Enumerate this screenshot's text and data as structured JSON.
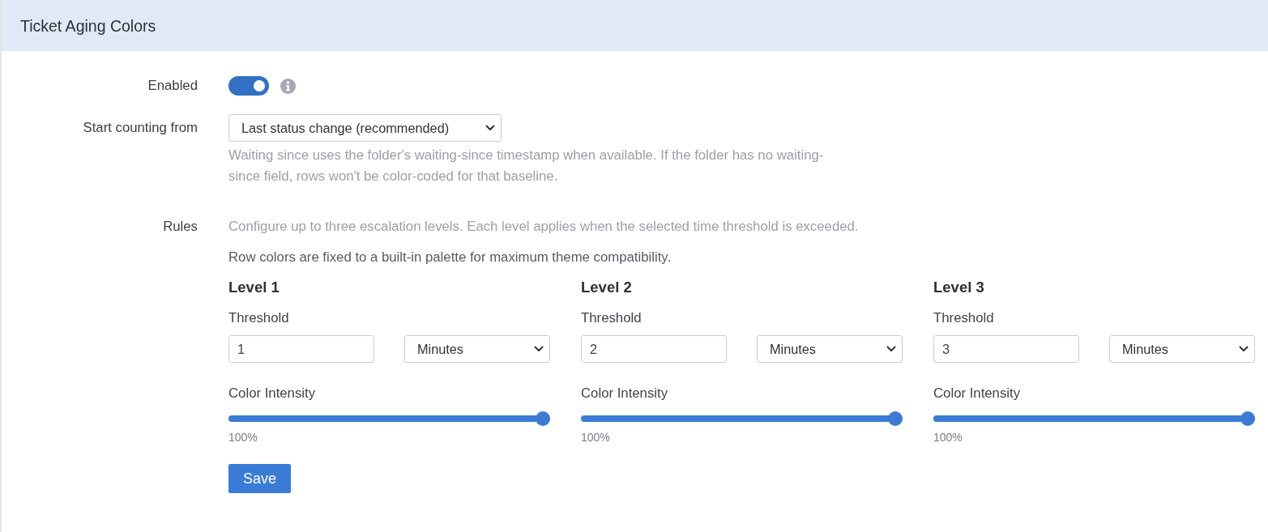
{
  "panel": {
    "title": "Ticket Aging Colors"
  },
  "enabled": {
    "label": "Enabled",
    "on": true
  },
  "start_counting": {
    "label": "Start counting from",
    "value": "Last status change (recommended)",
    "help": "Waiting since uses the folder's waiting-since timestamp when available. If the folder has no waiting-since field, rows won't be color-coded for that baseline."
  },
  "rules": {
    "label": "Rules",
    "description": "Configure up to three escalation levels. Each level applies when the selected time threshold is exceeded.",
    "note": "Row colors are fixed to a built-in palette for maximum theme compatibility.",
    "levels": [
      {
        "title": "Level 1",
        "threshold_label": "Threshold",
        "threshold": "1",
        "unit": "Minutes",
        "intensity_label": "Color Intensity",
        "level": 1,
        "reading": "100%"
      },
      {
        "title": "Level 2",
        "threshold_label": "Threshold",
        "threshold": "2",
        "unit": "Minutes",
        "intensity_label": "Color Intensity",
        "level": 1,
        "reading": "100%"
      },
      {
        "title": "Level 3",
        "threshold_label": "Threshold",
        "threshold": "3",
        "unit": "Minutes",
        "intensity_label": "Color Intensity",
        "level": 1,
        "reading": "100%"
      }
    ]
  },
  "save_button": "Save"
}
